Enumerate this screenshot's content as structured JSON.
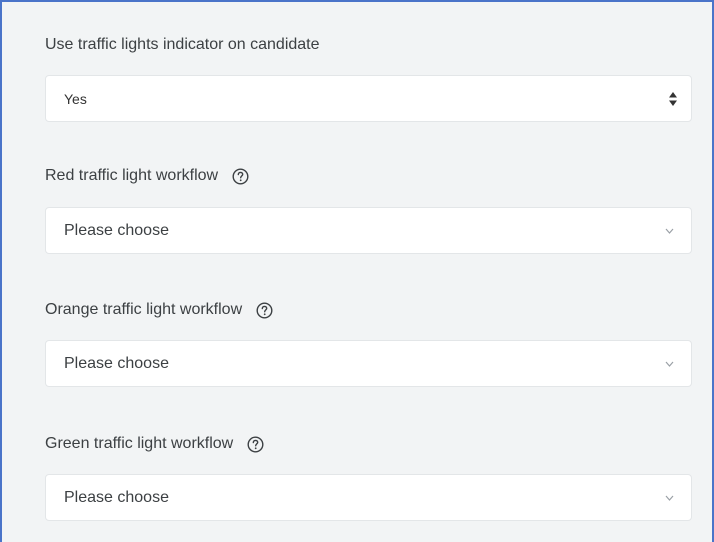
{
  "fields": [
    {
      "label": "Use traffic lights indicator on candidate",
      "value": "Yes",
      "control": "native-select",
      "has_help": false
    },
    {
      "label": "Red traffic light workflow",
      "value": "Please choose",
      "control": "dropdown",
      "has_help": true,
      "help_icon": "help-circle-icon"
    },
    {
      "label": "Orange traffic light workflow",
      "value": "Please choose",
      "control": "dropdown",
      "has_help": true,
      "help_icon": "help-circle-icon"
    },
    {
      "label": "Green traffic light workflow",
      "value": "Please choose",
      "control": "dropdown",
      "has_help": true,
      "help_icon": "help-circle-icon"
    }
  ],
  "colors": {
    "panel_border": "#4a74c9",
    "panel_background": "#f2f4f5",
    "input_background": "#ffffff",
    "input_border": "#e3e6e8",
    "text": "#3c4043",
    "chevron": "#9aa0a6"
  }
}
